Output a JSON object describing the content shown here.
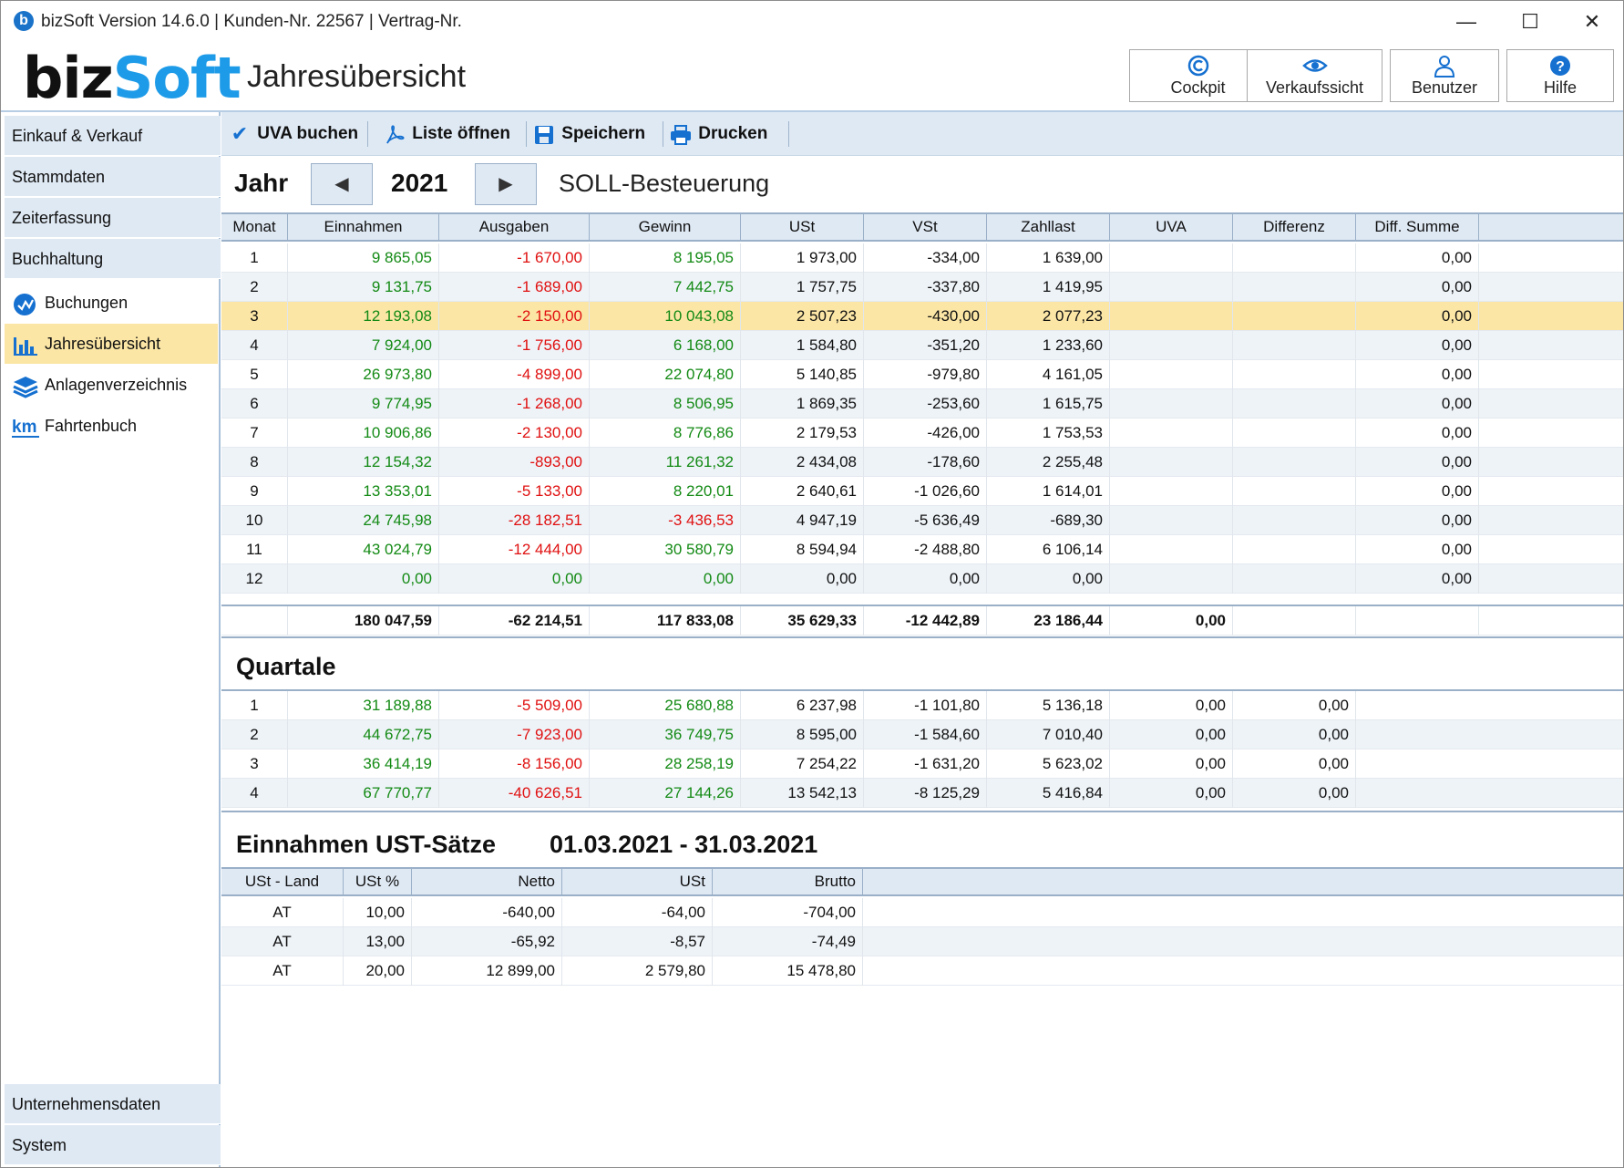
{
  "window": {
    "title": "bizSoft Version 14.6.0 | Kunden-Nr. 22567 | Vertrag-Nr.",
    "minimize": "—",
    "maximize": "☐",
    "close": "✕"
  },
  "header": {
    "logo_part1": "biz",
    "logo_part2": "Soft",
    "page_title": "Jahresübersicht",
    "buttons": [
      {
        "label": "Cockpit",
        "icon": "copyright-icon"
      },
      {
        "label": "Verkaufssicht",
        "icon": "eye-icon"
      },
      {
        "label": "Benutzer",
        "icon": "user-icon"
      },
      {
        "label": "Hilfe",
        "icon": "help-icon"
      }
    ]
  },
  "sidebar": {
    "sections_top": [
      "Einkauf & Verkauf",
      "Stammdaten",
      "Zeiterfassung",
      "Buchhaltung"
    ],
    "items": [
      {
        "label": "Buchungen",
        "icon": "checkmark-circle-icon"
      },
      {
        "label": "Jahresübersicht",
        "icon": "bar-chart-icon"
      },
      {
        "label": "Anlagenverzeichnis",
        "icon": "layers-icon"
      },
      {
        "label": "Fahrtenbuch",
        "icon": "km-icon"
      }
    ],
    "sections_bottom": [
      "Unternehmensdaten",
      "System"
    ]
  },
  "toolbar": {
    "uva_buchen": "UVA buchen",
    "liste_oeffnen": "Liste öffnen",
    "speichern": "Speichern",
    "drucken": "Drucken"
  },
  "year_selector": {
    "label": "Jahr",
    "year": "2021",
    "mode": "SOLL-Besteuerung"
  },
  "monthly": {
    "columns": [
      "Monat",
      "Einnahmen",
      "Ausgaben",
      "Gewinn",
      "USt",
      "VSt",
      "Zahllast",
      "UVA",
      "Differenz",
      "Diff. Summe"
    ],
    "selected_row": 2,
    "rows": [
      [
        "1",
        "9 865,05",
        "-1 670,00",
        "8 195,05",
        "1 973,00",
        "-334,00",
        "1 639,00",
        "",
        "",
        "0,00"
      ],
      [
        "2",
        "9 131,75",
        "-1 689,00",
        "7 442,75",
        "1 757,75",
        "-337,80",
        "1 419,95",
        "",
        "",
        "0,00"
      ],
      [
        "3",
        "12 193,08",
        "-2 150,00",
        "10 043,08",
        "2 507,23",
        "-430,00",
        "2 077,23",
        "",
        "",
        "0,00"
      ],
      [
        "4",
        "7 924,00",
        "-1 756,00",
        "6 168,00",
        "1 584,80",
        "-351,20",
        "1 233,60",
        "",
        "",
        "0,00"
      ],
      [
        "5",
        "26 973,80",
        "-4 899,00",
        "22 074,80",
        "5 140,85",
        "-979,80",
        "4 161,05",
        "",
        "",
        "0,00"
      ],
      [
        "6",
        "9 774,95",
        "-1 268,00",
        "8 506,95",
        "1 869,35",
        "-253,60",
        "1 615,75",
        "",
        "",
        "0,00"
      ],
      [
        "7",
        "10 906,86",
        "-2 130,00",
        "8 776,86",
        "2 179,53",
        "-426,00",
        "1 753,53",
        "",
        "",
        "0,00"
      ],
      [
        "8",
        "12 154,32",
        "-893,00",
        "11 261,32",
        "2 434,08",
        "-178,60",
        "2 255,48",
        "",
        "",
        "0,00"
      ],
      [
        "9",
        "13 353,01",
        "-5 133,00",
        "8 220,01",
        "2 640,61",
        "-1 026,60",
        "1 614,01",
        "",
        "",
        "0,00"
      ],
      [
        "10",
        "24 745,98",
        "-28 182,51",
        "-3 436,53",
        "4 947,19",
        "-5 636,49",
        "-689,30",
        "",
        "",
        "0,00"
      ],
      [
        "11",
        "43 024,79",
        "-12 444,00",
        "30 580,79",
        "8 594,94",
        "-2 488,80",
        "6 106,14",
        "",
        "",
        "0,00"
      ],
      [
        "12",
        "0,00",
        "0,00",
        "0,00",
        "0,00",
        "0,00",
        "0,00",
        "",
        "",
        "0,00"
      ]
    ],
    "totals": [
      "",
      "180 047,59",
      "-62 214,51",
      "117 833,08",
      "35 629,33",
      "-12 442,89",
      "23 186,44",
      "0,00",
      "",
      ""
    ]
  },
  "quarters": {
    "title": "Quartale",
    "rows": [
      [
        "1",
        "31 189,88",
        "-5 509,00",
        "25 680,88",
        "6 237,98",
        "-1 101,80",
        "5 136,18",
        "0,00",
        "0,00"
      ],
      [
        "2",
        "44 672,75",
        "-7 923,00",
        "36 749,75",
        "8 595,00",
        "-1 584,60",
        "7 010,40",
        "0,00",
        "0,00"
      ],
      [
        "3",
        "36 414,19",
        "-8 156,00",
        "28 258,19",
        "7 254,22",
        "-1 631,20",
        "5 623,02",
        "0,00",
        "0,00"
      ],
      [
        "4",
        "67 770,77",
        "-40 626,51",
        "27 144,26",
        "13 542,13",
        "-8 125,29",
        "5 416,84",
        "0,00",
        "0,00"
      ]
    ]
  },
  "ust_rates": {
    "title": "Einnahmen UST-Sätze",
    "period": "01.03.2021 - 31.03.2021",
    "columns": [
      "USt - Land",
      "USt %",
      "Netto",
      "USt",
      "Brutto"
    ],
    "rows": [
      [
        "AT",
        "10,00",
        "-640,00",
        "-64,00",
        "-704,00"
      ],
      [
        "AT",
        "13,00",
        "-65,92",
        "-8,57",
        "-74,49"
      ],
      [
        "AT",
        "20,00",
        "12 899,00",
        "2 579,80",
        "15 478,80"
      ]
    ]
  },
  "colors": {
    "positive": "#138a14",
    "negative": "#e01010",
    "selection": "#fbe6a6",
    "header_bg": "#dfe9f4",
    "accent": "#1570d0"
  }
}
